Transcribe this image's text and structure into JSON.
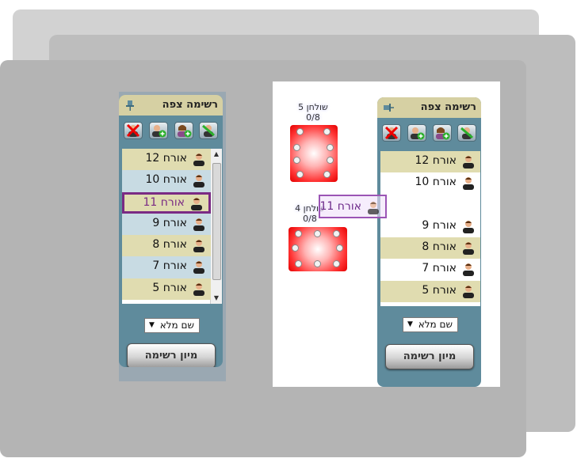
{
  "left_panel": {
    "title": "רשימה צפה",
    "pin_icon": "pin-icon",
    "toolbar": [
      "remove-guest-icon",
      "add-guest-icon",
      "add-female-guest-icon",
      "edit-guest-icon"
    ],
    "rows": [
      {
        "label": "אורח 12",
        "highlight": true,
        "selected": false
      },
      {
        "label": "אורח 10",
        "highlight": false,
        "selected": false
      },
      {
        "label": "אורח 11",
        "highlight": true,
        "selected": true
      },
      {
        "label": "אורח 9",
        "highlight": false,
        "selected": false
      },
      {
        "label": "אורח 8",
        "highlight": true,
        "selected": false
      },
      {
        "label": "אורח 7",
        "highlight": false,
        "selected": false
      },
      {
        "label": "אורח 5",
        "highlight": true,
        "selected": false
      }
    ],
    "sort_field": "שם מלא",
    "sort_button": "מיון רשימה"
  },
  "right_panel": {
    "title": "רשימה צפה",
    "pin_icon": "unpin-icon",
    "toolbar": [
      "remove-guest-icon",
      "add-guest-icon",
      "add-female-guest-icon",
      "edit-guest-icon"
    ],
    "rows": [
      {
        "label": "אורח 12",
        "highlight": true
      },
      {
        "label": "אורח 10",
        "highlight": false
      },
      {
        "label": "",
        "highlight": false
      },
      {
        "label": "אורח 9",
        "highlight": false
      },
      {
        "label": "אורח 8",
        "highlight": true
      },
      {
        "label": "אורח 7",
        "highlight": false
      },
      {
        "label": "אורח 5",
        "highlight": true
      }
    ],
    "sort_field": "שם מלא",
    "sort_button": "מיון רשימה"
  },
  "tables": [
    {
      "name": "שולחן 5",
      "count": "0/8"
    },
    {
      "name": "שולחן 4",
      "count": "0/8"
    }
  ],
  "dragging": {
    "label": "אורח 11"
  },
  "colors": {
    "panel_bg": "#5f8b9c",
    "header_bg": "#d6d0a3",
    "row_highlight": "#e0dcb0",
    "row_plain": "#ffffff",
    "row_light_blue": "#c8dbe3",
    "selected_border": "#7a2a84",
    "table_red": "#ff3333"
  }
}
